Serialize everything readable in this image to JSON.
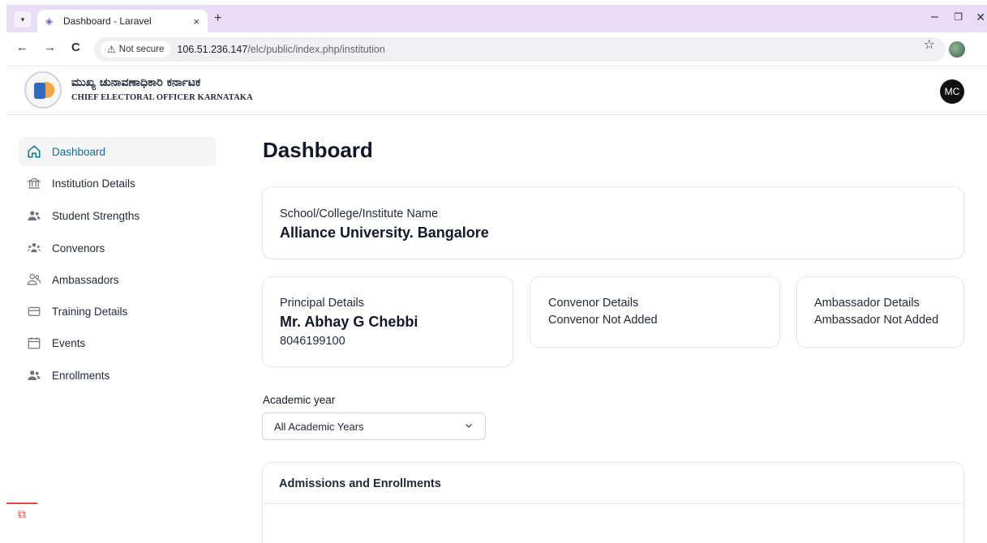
{
  "browser": {
    "tab_title": "Dashboard - Laravel",
    "tab_close": "×",
    "new_tab": "+",
    "not_secure_label": "Not secure",
    "url_host": "106.51.236.147",
    "url_path": "/elc/public/index.php/institution",
    "back": "←",
    "forward": "→",
    "reload": "C"
  },
  "header": {
    "org_name_kannada": "ಮುಖ್ಯ ಚುನಾವಣಾಧಿಕಾರಿ ಕರ್ನಾಟಕ",
    "org_name_english": "CHIEF ELECTORAL OFFICER KARNATAKA",
    "user_initials": "MC"
  },
  "sidebar": {
    "items": [
      {
        "label": "Dashboard",
        "icon": "home-icon",
        "active": true
      },
      {
        "label": "Institution Details",
        "icon": "institution-icon",
        "active": false
      },
      {
        "label": "Student Strengths",
        "icon": "users-icon",
        "active": false
      },
      {
        "label": "Convenors",
        "icon": "group-icon",
        "active": false
      },
      {
        "label": "Ambassadors",
        "icon": "people-outline-icon",
        "active": false
      },
      {
        "label": "Training Details",
        "icon": "folder-icon",
        "active": false
      },
      {
        "label": "Events",
        "icon": "calendar-icon",
        "active": false
      },
      {
        "label": "Enrollments",
        "icon": "users-icon",
        "active": false
      }
    ]
  },
  "main": {
    "page_title": "Dashboard",
    "institution": {
      "label": "School/College/Institute Name",
      "value": "Alliance University. Bangalore"
    },
    "principal": {
      "label": "Principal Details",
      "name": "Mr. Abhay G Chebbi",
      "phone": "8046199100"
    },
    "convenor": {
      "label": "Convenor Details",
      "value": "Convenor Not Added"
    },
    "ambassador": {
      "label": "Ambassador Details",
      "value": "Ambassador Not Added"
    },
    "academic_year": {
      "label": "Academic year",
      "selected": "All Academic Years"
    },
    "enrollments_card": {
      "title": "Admissions and Enrollments"
    }
  },
  "colors": {
    "accent": "#0e7490",
    "tab_strip": "#e9dcf7",
    "laravel_red": "#ef4444"
  }
}
